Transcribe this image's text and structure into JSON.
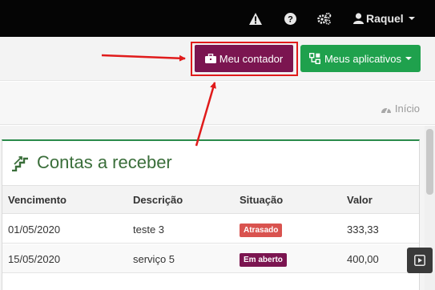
{
  "topbar": {
    "icons": [
      "warning-icon",
      "help-icon",
      "settings-icon"
    ],
    "user": {
      "icon": "user-icon",
      "name": "Raquel"
    }
  },
  "actions": {
    "contador": {
      "label": "Meu contador",
      "icon": "briefcase-icon",
      "color": "#7b1550"
    },
    "apps": {
      "label": "Meus aplicativos",
      "icon": "apps-icon",
      "color": "#1fa14d"
    }
  },
  "breadcrumb": {
    "icon": "dashboard-icon",
    "label": "Início"
  },
  "panel": {
    "icon": "stairs-icon",
    "title": "Contas a receber",
    "accent": "#2a8a4a",
    "columns": [
      "Vencimento",
      "Descrição",
      "Situação",
      "Valor"
    ],
    "rows": [
      {
        "vencimento": "01/05/2020",
        "descricao": "teste 3",
        "situacao": "Atrasado",
        "valor": "333,33"
      },
      {
        "vencimento": "15/05/2020",
        "descricao": "serviço 5",
        "situacao": "Em aberto",
        "valor": "400,00"
      }
    ]
  },
  "status_colors": {
    "atrasado": "#d9534f",
    "em_aberto": "#7b1550"
  },
  "annotation_color": "#e01b1b"
}
